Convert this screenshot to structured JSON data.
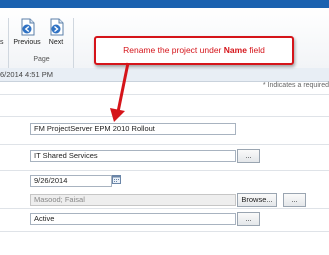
{
  "ribbon": {
    "left_fragment": "s",
    "previous_label": "Previous",
    "next_label": "Next",
    "group_label": "Page"
  },
  "status": {
    "date_text": "6/2014 4:51 PM"
  },
  "form": {
    "required_note": "* Indicates a required",
    "name_value": "FM ProjectServer EPM 2010 Rollout",
    "department_value": "IT Shared Services",
    "department_picker_label": "...",
    "start_date_value": "9/26/2014",
    "owner_value": "Masood; Faisal",
    "owner_browse_label": "Browse...",
    "owner_picker_label": "...",
    "status_value": "Active",
    "status_picker_label": "..."
  },
  "callout": {
    "text_before": "Rename the project under ",
    "bold_word": "Name",
    "text_after": " field",
    "color": "#d5141a"
  },
  "colors": {
    "top_bar": "#1b62b0",
    "accent_red": "#d5141a"
  },
  "icons": [
    "previous-page-icon",
    "next-page-icon",
    "calendar-icon"
  ]
}
